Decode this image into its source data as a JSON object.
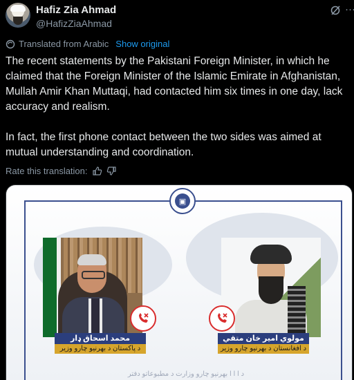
{
  "tweet": {
    "author_name": "Hafiz Zia Ahmad",
    "author_handle": "@HafizZiaAhmad",
    "translated_label": "Translated from Arabic",
    "show_original": "Show original",
    "paragraphs": [
      "The recent statements by the Pakistani Foreign Minister, in which he claimed that the Foreign Minister of the Islamic Emirate in Afghanistan, Mullah Amir Khan Muttaqi, had contacted him six times in one day, lack accuracy and realism.",
      "In fact, the first phone contact between the two sides was aimed at mutual understanding and coordination."
    ],
    "rate_label": "Rate this translation:"
  },
  "media": {
    "left_name": "محمد اسحاق ډار",
    "left_title": "د پاکستان د بهرنیو چارو وزیر",
    "right_name": "مولوي امیر خان متقي",
    "right_title": "د افغانستان د بهرنیو چارو وزیر",
    "bottom_text": "د ا ا ا بهرنیو چارو وزارت د مطبوعاتو دفتر"
  },
  "icons": {
    "more": "more-horizontal-icon",
    "grok": "grok-icon",
    "translate": "translate-icon",
    "thumbs_up": "thumbs-up-icon",
    "thumbs_down": "thumbs-down-icon",
    "call_end": "phone-call-ended-icon"
  },
  "colors": {
    "background": "#000000",
    "text": "#e7e9ea",
    "muted": "#8b98a5",
    "accent": "#1d9bf0",
    "frame_blue": "#3a4f8e",
    "caption_gold": "#d6a52c",
    "call_red": "#d92d2d"
  }
}
